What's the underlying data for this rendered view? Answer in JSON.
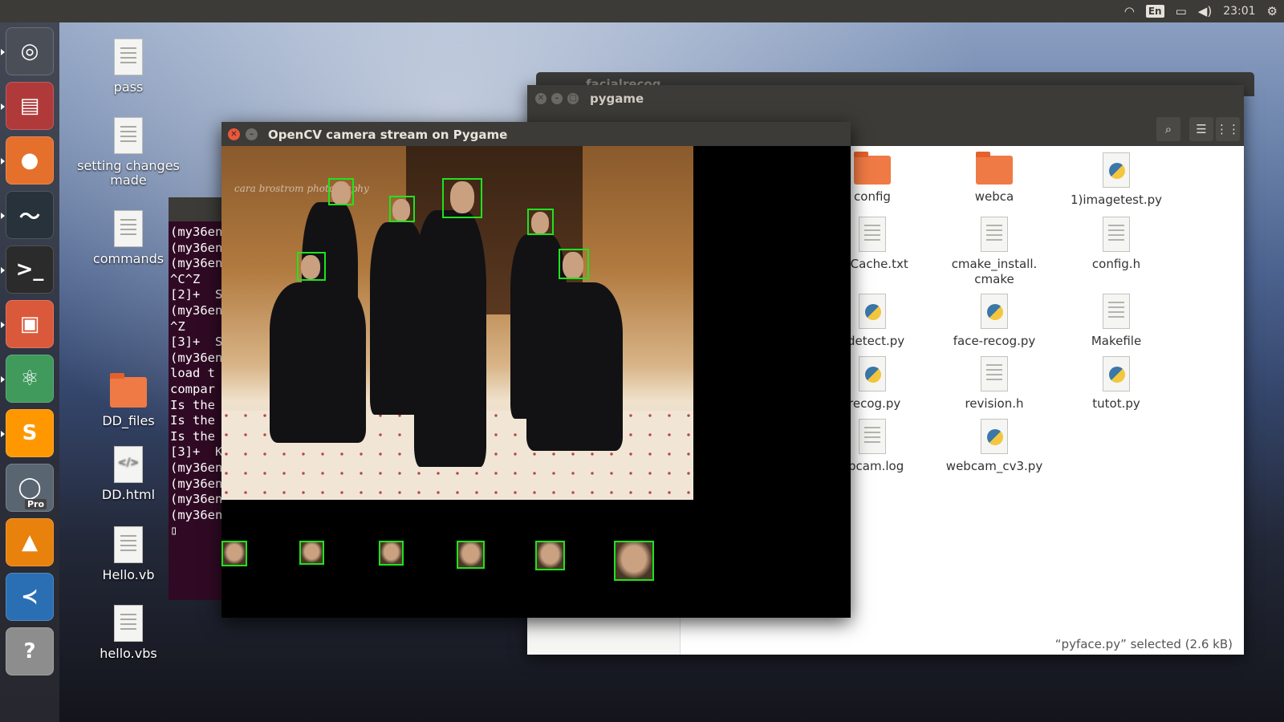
{
  "topbar": {
    "lang": "En",
    "clock": "23:01"
  },
  "launcher": {
    "items": [
      {
        "name": "ubuntu-dash",
        "glyph": "◎",
        "color": "#4a4f57"
      },
      {
        "name": "files-cabinet",
        "glyph": "▤",
        "color": "#b03a3a"
      },
      {
        "name": "firefox",
        "glyph": "●",
        "color": "#e4702c"
      },
      {
        "name": "system-monitor",
        "glyph": "〜",
        "color": "#27323a"
      },
      {
        "name": "terminal",
        "glyph": ">_",
        "color": "#2b2b2b"
      },
      {
        "name": "file-manager",
        "glyph": "▣",
        "color": "#d9593a"
      },
      {
        "name": "atom",
        "glyph": "⚛",
        "color": "#3f9a5c"
      },
      {
        "name": "sublime-text",
        "glyph": "S",
        "color": "#ff9800"
      },
      {
        "name": "google-earth-pro",
        "glyph": "◯",
        "color": "#5a6572"
      },
      {
        "name": "vlc",
        "glyph": "▲",
        "color": "#e8820c"
      },
      {
        "name": "visual-studio-code",
        "glyph": "≺",
        "color": "#2a6fb3"
      },
      {
        "name": "help",
        "glyph": "?",
        "color": "#8d8d8d"
      }
    ],
    "pro_badge": "Pro"
  },
  "desktop": {
    "icons": [
      {
        "label": "pass",
        "type": "file"
      },
      {
        "label": "setting changes made",
        "type": "file"
      },
      {
        "label": "commands",
        "type": "file"
      },
      {
        "label": "DD_files",
        "type": "folder"
      },
      {
        "label": "DD.html",
        "type": "html"
      },
      {
        "label": "Hello.vb",
        "type": "file"
      },
      {
        "label": "hello.vbs",
        "type": "file"
      }
    ]
  },
  "filemanager": {
    "back_title": "facialrecog",
    "title": "pygame",
    "items": [
      {
        "label": "config",
        "type": "folder"
      },
      {
        "label": "webca",
        "type": "folder"
      },
      {
        "label": "1)imagetest.py",
        "type": "py"
      },
      {
        "label": "keCache.txt",
        "type": "doc"
      },
      {
        "label": "cmake_install.\ncmake",
        "type": "doc"
      },
      {
        "label": "config.h",
        "type": "doc"
      },
      {
        "label": "edetect.py",
        "type": "py"
      },
      {
        "label": "face-recog.py",
        "type": "py"
      },
      {
        "label": "Makefile",
        "type": "doc"
      },
      {
        "label": "frecog.py",
        "type": "py"
      },
      {
        "label": "revision.h",
        "type": "doc"
      },
      {
        "label": "tutot.py",
        "type": "py"
      },
      {
        "label": "ebcam.log",
        "type": "doc"
      },
      {
        "label": "webcam_cv3.py",
        "type": "py"
      }
    ],
    "status": "“pyface.py” selected (2.6 kB)"
  },
  "terminal": {
    "lines": [
      "(my36en",
      "(my36en",
      "(my36en",
      "^C^Z",
      "[2]+  S",
      "(my36en",
      "^Z",
      "[3]+  S",
      "(my36en",
      "load t",
      "compar",
      "Is the",
      "Is the",
      "Is the",
      "[3]+  K",
      "(my36en",
      "(my36en",
      "(my36en",
      "(my36en",
      "▯"
    ]
  },
  "opencv": {
    "title": "OpenCV camera stream on Pygame",
    "watermark": "cara brostrom photography",
    "face_count": 6
  }
}
